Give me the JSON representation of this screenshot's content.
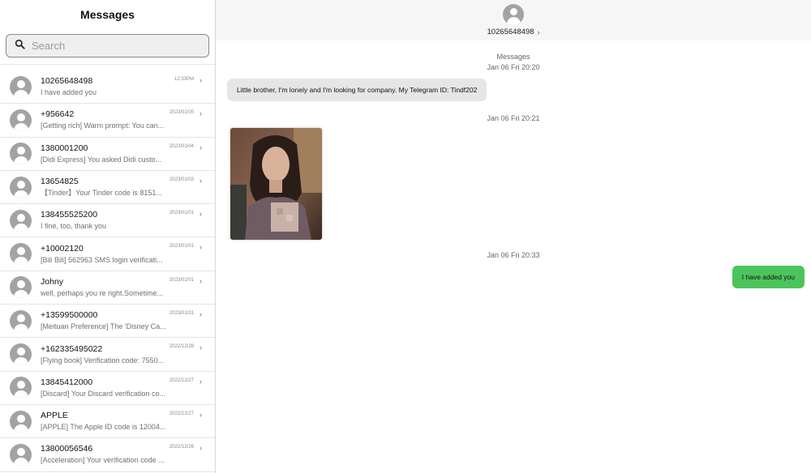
{
  "sidebar": {
    "title": "Messages",
    "search_placeholder": "Search",
    "conversations": [
      {
        "name": "10265648498",
        "preview": "I have added you",
        "date": "12:33PM"
      },
      {
        "name": "+956642",
        "preview": "[Getting rich] Warm prompt: You can...",
        "date": "2023/01/05"
      },
      {
        "name": "1380001200",
        "preview": "[Didi Express] You asked Didi custo...",
        "date": "2023/01/04"
      },
      {
        "name": "13654825",
        "preview": "【Tinder】Your Tinder code is 8151...",
        "date": "2023/01/03"
      },
      {
        "name": "138455525200",
        "preview": "I fine, too, thank you",
        "date": "2023/01/01"
      },
      {
        "name": "+10002120",
        "preview": "[Bili Bili] 562963 SMS login verificati...",
        "date": "2023/01/01"
      },
      {
        "name": "Johny",
        "preview": "well, perhaps you re right.Sometime...",
        "date": "2023/01/01"
      },
      {
        "name": "+13599500000",
        "preview": "[Meituan Preference] The 'Disney Ca...",
        "date": "2023/01/01"
      },
      {
        "name": "+162335495022",
        "preview": "[Flying book] Verification code: 7550...",
        "date": "2022/12/28"
      },
      {
        "name": "13845412000",
        "preview": "[Discard] Your Discard verification co...",
        "date": "2022/12/27"
      },
      {
        "name": "APPLE",
        "preview": "[APPLE] The Apple ID code is 12004...",
        "date": "2022/12/27"
      },
      {
        "name": "13800056546",
        "preview": "[Acceleration] Your verification code ...",
        "date": "2022/12/26"
      }
    ]
  },
  "chat": {
    "contact": "10265648498",
    "service_label": "Messages",
    "timestamp1": "Jan 06 Fri 20:20",
    "message1": "Little brother, I'm lonely and I'm looking for company. My Telegram ID: Tindf202",
    "timestamp2": "Jan 06 Fri 20:21",
    "timestamp3": "Jan 06 Fri 20:33",
    "message_out": "I have added you"
  },
  "colors": {
    "outgoing_bubble": "#4cc45c",
    "incoming_bubble": "#e6e6e6",
    "avatar": "#a3a3a3"
  }
}
